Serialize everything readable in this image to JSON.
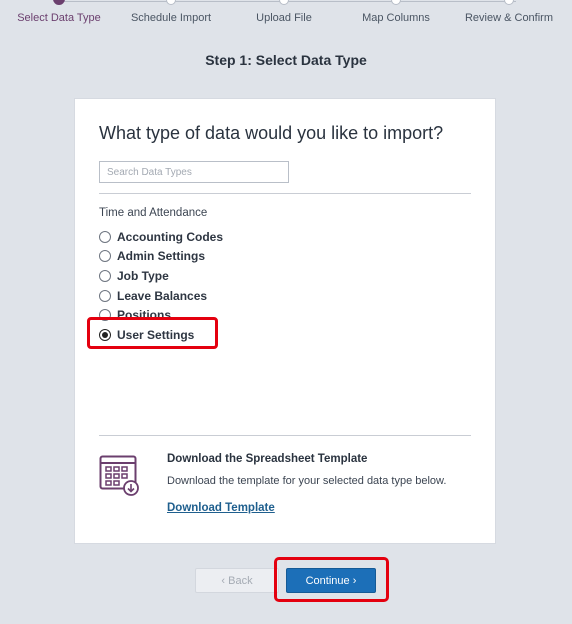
{
  "stepper": {
    "steps": [
      {
        "label": "Select Data Type",
        "active": true
      },
      {
        "label": "Schedule Import",
        "active": false
      },
      {
        "label": "Upload File",
        "active": false
      },
      {
        "label": "Map Columns",
        "active": false
      },
      {
        "label": "Review & Confirm",
        "active": false
      }
    ]
  },
  "page_heading": "Step 1: Select Data Type",
  "card": {
    "title": "What type of data would you like to import?",
    "search_placeholder": "Search Data Types",
    "group_label": "Time and Attendance",
    "options": [
      {
        "label": "Accounting Codes",
        "selected": false
      },
      {
        "label": "Admin Settings",
        "selected": false
      },
      {
        "label": "Job Type",
        "selected": false
      },
      {
        "label": "Leave Balances",
        "selected": false
      },
      {
        "label": "Positions",
        "selected": false
      },
      {
        "label": "User Settings",
        "selected": true
      }
    ],
    "template": {
      "title": "Download the Spreadsheet Template",
      "description": "Download the template for your selected data type below.",
      "link": "Download Template"
    }
  },
  "buttons": {
    "back": "‹ Back",
    "continue": "Continue ›"
  },
  "colors": {
    "accent": "#6b3f6e",
    "primary_button": "#1c6fb8",
    "highlight": "#e4000f",
    "link": "#1f5f8e"
  }
}
